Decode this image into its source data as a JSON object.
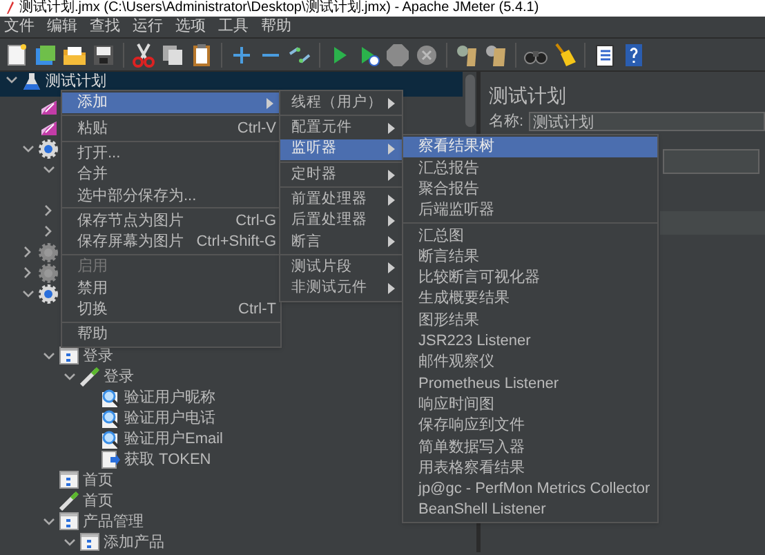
{
  "window": {
    "title": "测试计划.jmx (C:\\Users\\Administrator\\Desktop\\测试计划.jmx) - Apache JMeter (5.4.1)"
  },
  "menu_bar": [
    "文件",
    "编辑",
    "查找",
    "运行",
    "选项",
    "工具",
    "帮助"
  ],
  "tree": [
    {
      "kind": "test_plan",
      "label": "测试计划",
      "selected": true,
      "expanded": true,
      "children": [
        {
          "kind": "listener"
        },
        {
          "kind": "listener"
        },
        {
          "kind": "thread_group",
          "disabled": false,
          "expanded": true,
          "children": [
            {
              "kind": "covered",
              "expanded": true,
              "children": [
                {
                  "kind": "covered"
                }
              ]
            },
            {
              "kind": "covered",
              "expanded": false
            },
            {
              "kind": "covered",
              "expanded": false
            }
          ]
        },
        {
          "kind": "thread_group",
          "disabled": true,
          "expanded": false
        },
        {
          "kind": "thread_group",
          "disabled": true,
          "expanded": false
        },
        {
          "kind": "thread_group",
          "disabled": false,
          "expanded": true,
          "children": [
            {
              "kind": "covered"
            },
            {
              "kind": "covered"
            },
            {
              "kind": "controller",
              "label": "登录",
              "expanded": true,
              "children": [
                {
                  "kind": "sampler",
                  "label": "登录",
                  "expanded": true,
                  "children": [
                    {
                      "kind": "assertion",
                      "label": "验证用户昵称"
                    },
                    {
                      "kind": "assertion",
                      "label": "验证用户电话"
                    },
                    {
                      "kind": "assertion",
                      "label": "验证用户Email"
                    },
                    {
                      "kind": "extractor",
                      "label": "获取 TOKEN"
                    }
                  ]
                }
              ]
            },
            {
              "kind": "controller",
              "label": "首页"
            },
            {
              "kind": "sampler",
              "label": "首页"
            },
            {
              "kind": "controller",
              "label": "产品管理",
              "expanded": true,
              "children": [
                {
                  "kind": "controller",
                  "label": "添加产品",
                  "expanded": true
                }
              ]
            }
          ]
        }
      ]
    }
  ],
  "editor": {
    "title": "测试计划",
    "name_label": "名称:",
    "name_value": "测试计划"
  },
  "context_menu": [
    {
      "kind": "item",
      "label": "添加",
      "submenu": true,
      "selected": true,
      "disabled": false
    },
    {
      "kind": "separator"
    },
    {
      "kind": "item",
      "label": "粘贴",
      "shortcut": "Ctrl-V",
      "submenu": false,
      "selected": false,
      "disabled": false
    },
    {
      "kind": "separator"
    },
    {
      "kind": "item",
      "label": "打开...",
      "submenu": false,
      "selected": false,
      "disabled": false
    },
    {
      "kind": "item",
      "label": "合并",
      "submenu": false,
      "selected": false,
      "disabled": false
    },
    {
      "kind": "item",
      "label": "选中部分保存为...",
      "submenu": false,
      "selected": false,
      "disabled": false
    },
    {
      "kind": "separator"
    },
    {
      "kind": "item",
      "label": "保存节点为图片",
      "shortcut": "Ctrl-G",
      "submenu": false,
      "selected": false,
      "disabled": false
    },
    {
      "kind": "item",
      "label": "保存屏幕为图片",
      "shortcut": "Ctrl+Shift-G",
      "submenu": false,
      "selected": false,
      "disabled": false
    },
    {
      "kind": "separator"
    },
    {
      "kind": "item",
      "label": "启用",
      "submenu": false,
      "selected": false,
      "disabled": true
    },
    {
      "kind": "item",
      "label": "禁用",
      "submenu": false,
      "selected": false,
      "disabled": false
    },
    {
      "kind": "item",
      "label": "切换",
      "shortcut": "Ctrl-T",
      "submenu": false,
      "selected": false,
      "disabled": false
    },
    {
      "kind": "separator"
    },
    {
      "kind": "item",
      "label": "帮助",
      "submenu": false,
      "selected": false,
      "disabled": false
    }
  ],
  "add_submenu": [
    {
      "kind": "item",
      "label": "线程（用户）",
      "submenu": true,
      "selected": false
    },
    {
      "kind": "separator"
    },
    {
      "kind": "item",
      "label": "配置元件",
      "submenu": true,
      "selected": false
    },
    {
      "kind": "item",
      "label": "监听器",
      "submenu": true,
      "selected": true
    },
    {
      "kind": "separator"
    },
    {
      "kind": "item",
      "label": "定时器",
      "submenu": true,
      "selected": false
    },
    {
      "kind": "separator"
    },
    {
      "kind": "item",
      "label": "前置处理器",
      "submenu": true,
      "selected": false
    },
    {
      "kind": "item",
      "label": "后置处理器",
      "submenu": true,
      "selected": false
    },
    {
      "kind": "item",
      "label": "断言",
      "submenu": true,
      "selected": false
    },
    {
      "kind": "separator"
    },
    {
      "kind": "item",
      "label": "测试片段",
      "submenu": true,
      "selected": false
    },
    {
      "kind": "item",
      "label": "非测试元件",
      "submenu": true,
      "selected": false
    }
  ],
  "listener_submenu": [
    {
      "kind": "item",
      "label": "察看结果树",
      "selected": true
    },
    {
      "kind": "item",
      "label": "汇总报告",
      "selected": false
    },
    {
      "kind": "item",
      "label": "聚合报告",
      "selected": false
    },
    {
      "kind": "item",
      "label": "后端监听器",
      "selected": false
    },
    {
      "kind": "separator"
    },
    {
      "kind": "item",
      "label": "汇总图",
      "selected": false
    },
    {
      "kind": "item",
      "label": "断言结果",
      "selected": false
    },
    {
      "kind": "item",
      "label": "比较断言可视化器",
      "selected": false
    },
    {
      "kind": "item",
      "label": "生成概要结果",
      "selected": false
    },
    {
      "kind": "item",
      "label": "图形结果",
      "selected": false
    },
    {
      "kind": "item",
      "label": "JSR223 Listener",
      "selected": false
    },
    {
      "kind": "item",
      "label": "邮件观察仪",
      "selected": false
    },
    {
      "kind": "item",
      "label": "Prometheus Listener",
      "selected": false
    },
    {
      "kind": "item",
      "label": "响应时间图",
      "selected": false
    },
    {
      "kind": "item",
      "label": "保存响应到文件",
      "selected": false
    },
    {
      "kind": "item",
      "label": "简单数据写入器",
      "selected": false
    },
    {
      "kind": "item",
      "label": "用表格察看结果",
      "selected": false
    },
    {
      "kind": "item",
      "label": "jp@gc - PerfMon Metrics Collector",
      "selected": false
    },
    {
      "kind": "item",
      "label": "BeanShell Listener",
      "selected": false
    }
  ]
}
